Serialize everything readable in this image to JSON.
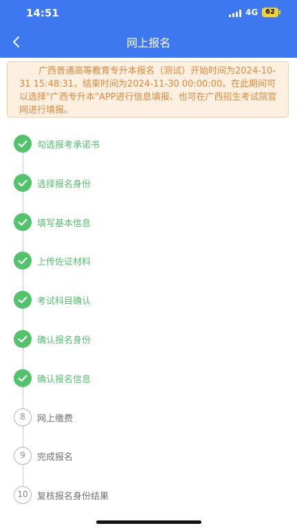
{
  "status": {
    "time": "14:51",
    "network": "4G",
    "battery": "62"
  },
  "nav": {
    "title": "网上报名"
  },
  "notice": {
    "text": "广西普通高等教育专升本报名（测试）开始时间为2024-10-31 15:48:31，结束时间为2024-11-30 00:00:00。在此期间可以选择\"广西专升本\"APP进行信息填报、也可在广西招生考试院官网进行填报。"
  },
  "colors": {
    "header": "#3e78f0",
    "done": "#52c26b",
    "pending": "#8a8a8a",
    "notice_text": "#e3873a",
    "notice_bg": "#fdf0e1"
  },
  "steps": [
    {
      "label": "勾选报考承诺书",
      "status": "done",
      "icon": "check-icon"
    },
    {
      "label": "选择报名身份",
      "status": "done",
      "icon": "check-icon"
    },
    {
      "label": "填写基本信息",
      "status": "done",
      "icon": "check-icon"
    },
    {
      "label": "上传佐证材料",
      "status": "done",
      "icon": "check-icon"
    },
    {
      "label": "考试科目确认",
      "status": "done",
      "icon": "check-icon"
    },
    {
      "label": "确认报名身份",
      "status": "done",
      "icon": "check-icon"
    },
    {
      "label": "确认报名信息",
      "status": "done",
      "icon": "check-icon"
    },
    {
      "label": "网上缴费",
      "status": "todo",
      "number": "8"
    },
    {
      "label": "完成报名",
      "status": "todo",
      "number": "9"
    },
    {
      "label": "复核报名身份结果",
      "status": "todo",
      "number": "10"
    }
  ]
}
